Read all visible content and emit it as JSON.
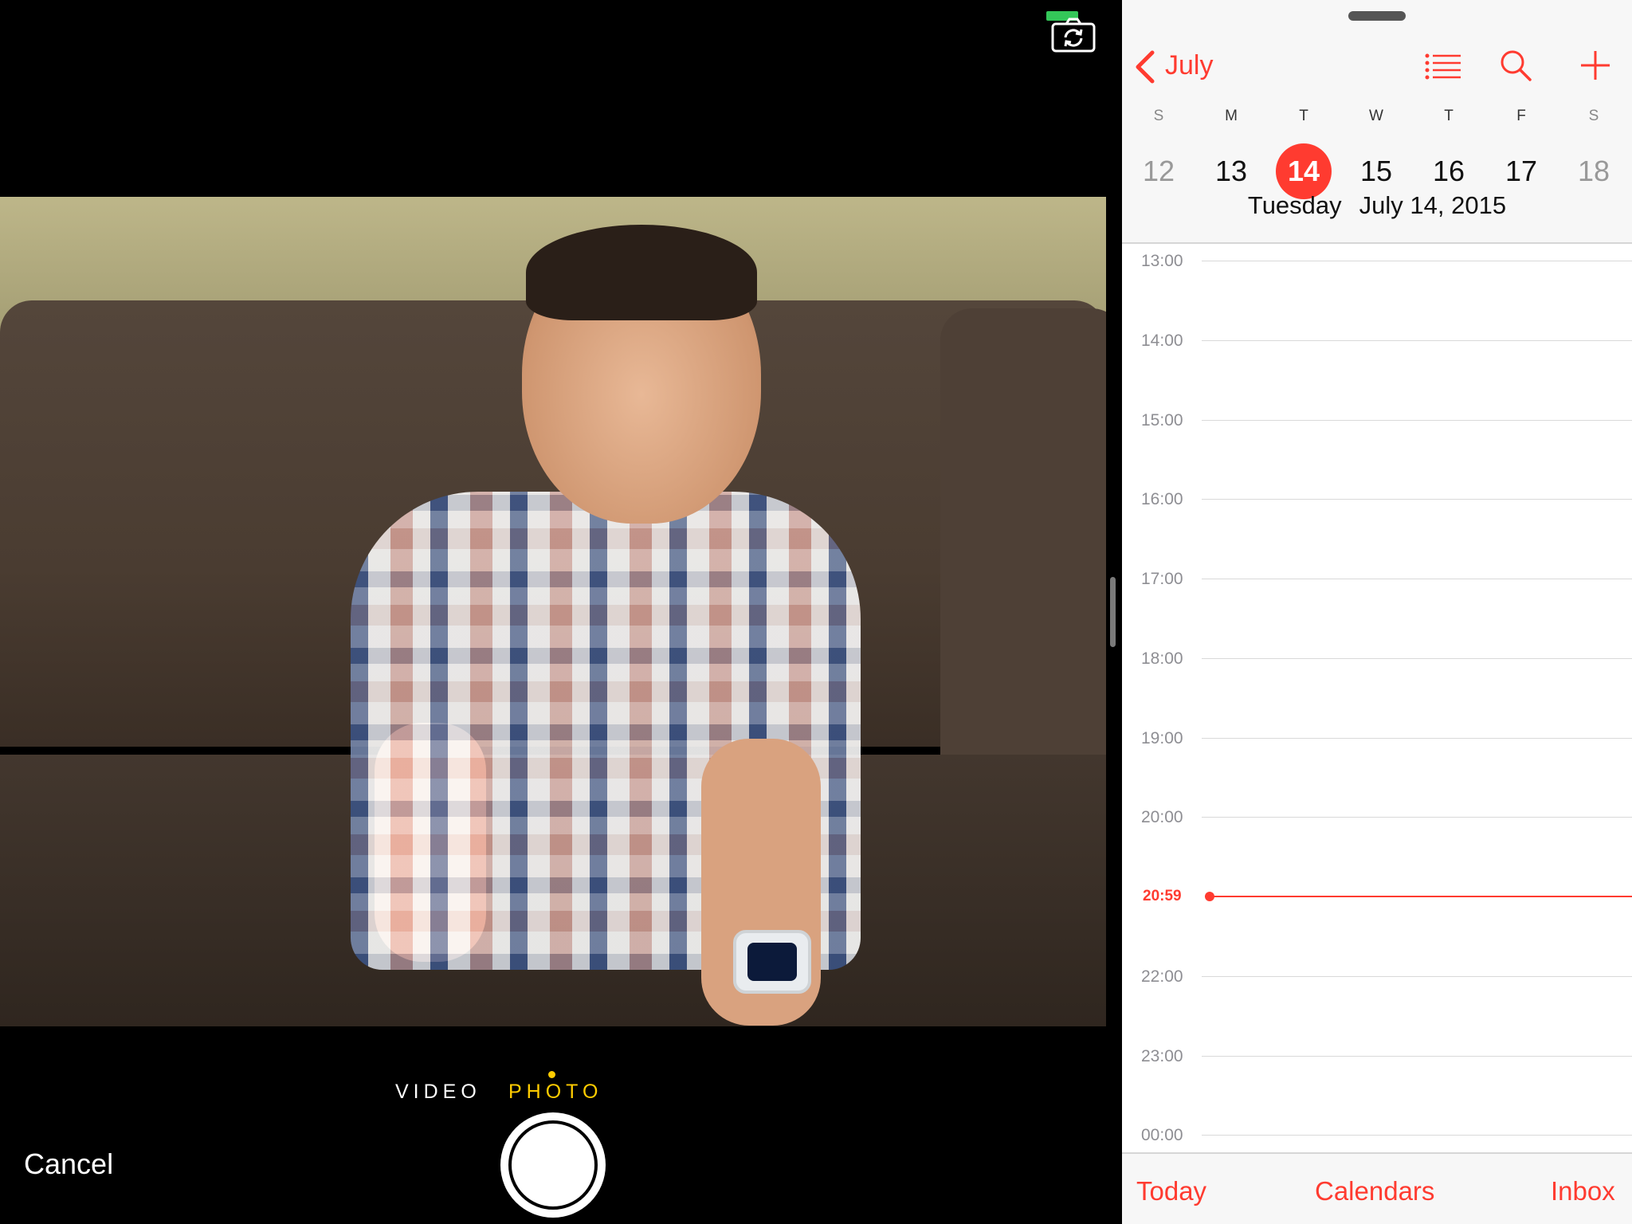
{
  "camera": {
    "modes": {
      "video": "VIDEO",
      "photo": "PHOTO",
      "selected": "PHOTO"
    },
    "cancel_label": "Cancel",
    "icons": {
      "flip": "camera-flip-icon",
      "shutter": "shutter-button"
    },
    "colors": {
      "selected_mode": "#ffcc00",
      "battery": "#34c759"
    }
  },
  "calendar": {
    "nav": {
      "back_label": "July",
      "icons": [
        "chevron-left-icon",
        "list-icon",
        "search-icon",
        "add-icon"
      ]
    },
    "weekdays": [
      "S",
      "M",
      "T",
      "W",
      "T",
      "F",
      "S"
    ],
    "days": [
      "12",
      "13",
      "14",
      "15",
      "16",
      "17",
      "18"
    ],
    "selected_day": "14",
    "caption": {
      "weekday": "Tuesday",
      "date": "July 14, 2015"
    },
    "hours": [
      "13:00",
      "14:00",
      "15:00",
      "16:00",
      "17:00",
      "18:00",
      "19:00",
      "20:00",
      "22:00",
      "23:00",
      "00:00"
    ],
    "current_time": "20:59",
    "toolbar": {
      "today": "Today",
      "calendars": "Calendars",
      "inbox": "Inbox"
    },
    "colors": {
      "accent": "#ff3b30"
    }
  }
}
